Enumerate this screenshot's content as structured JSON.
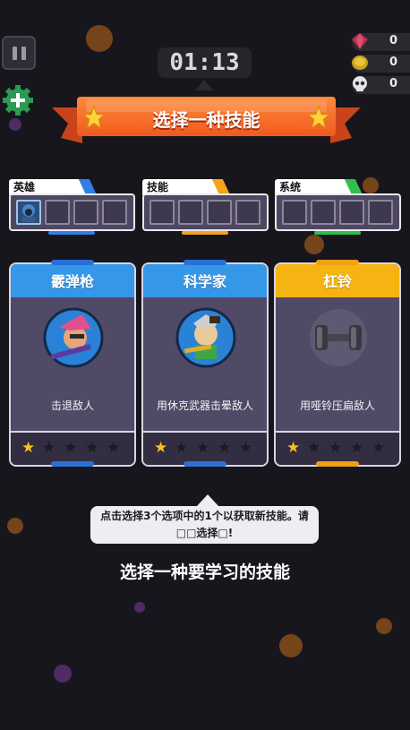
{
  "hud": {
    "timer": "01:13",
    "gems": "0",
    "coins": "0",
    "kills": "0"
  },
  "banner": {
    "title": "选择一种技能"
  },
  "panels": [
    {
      "label": "英雄",
      "accent": "#2f7fe6"
    },
    {
      "label": "技能",
      "accent": "#f6a21a"
    },
    {
      "label": "系统",
      "accent": "#2fbf4a"
    }
  ],
  "cards": [
    {
      "name": "霰弹枪",
      "description": "击退敌人",
      "header_color": "#3597e8",
      "stars": 1,
      "max_stars": 5
    },
    {
      "name": "科学家",
      "description": "用休克武器击晕敌人",
      "header_color": "#3597e8",
      "stars": 1,
      "max_stars": 5
    },
    {
      "name": "杠铃",
      "description": "用哑铃压扁敌人",
      "header_color": "#f6b412",
      "stars": 1,
      "max_stars": 5
    }
  ],
  "tooltip": {
    "text": "点击选择3个选项中的1个以获取新技能。请□□选择□!"
  },
  "prompt": {
    "text": "选择一种要学习的技能"
  },
  "icons": {
    "pause": "pause-icon",
    "gem": "gem-icon",
    "coin": "coin-icon",
    "skull": "skull-icon",
    "plus": "plus-gear-icon",
    "star": "star-icon"
  }
}
